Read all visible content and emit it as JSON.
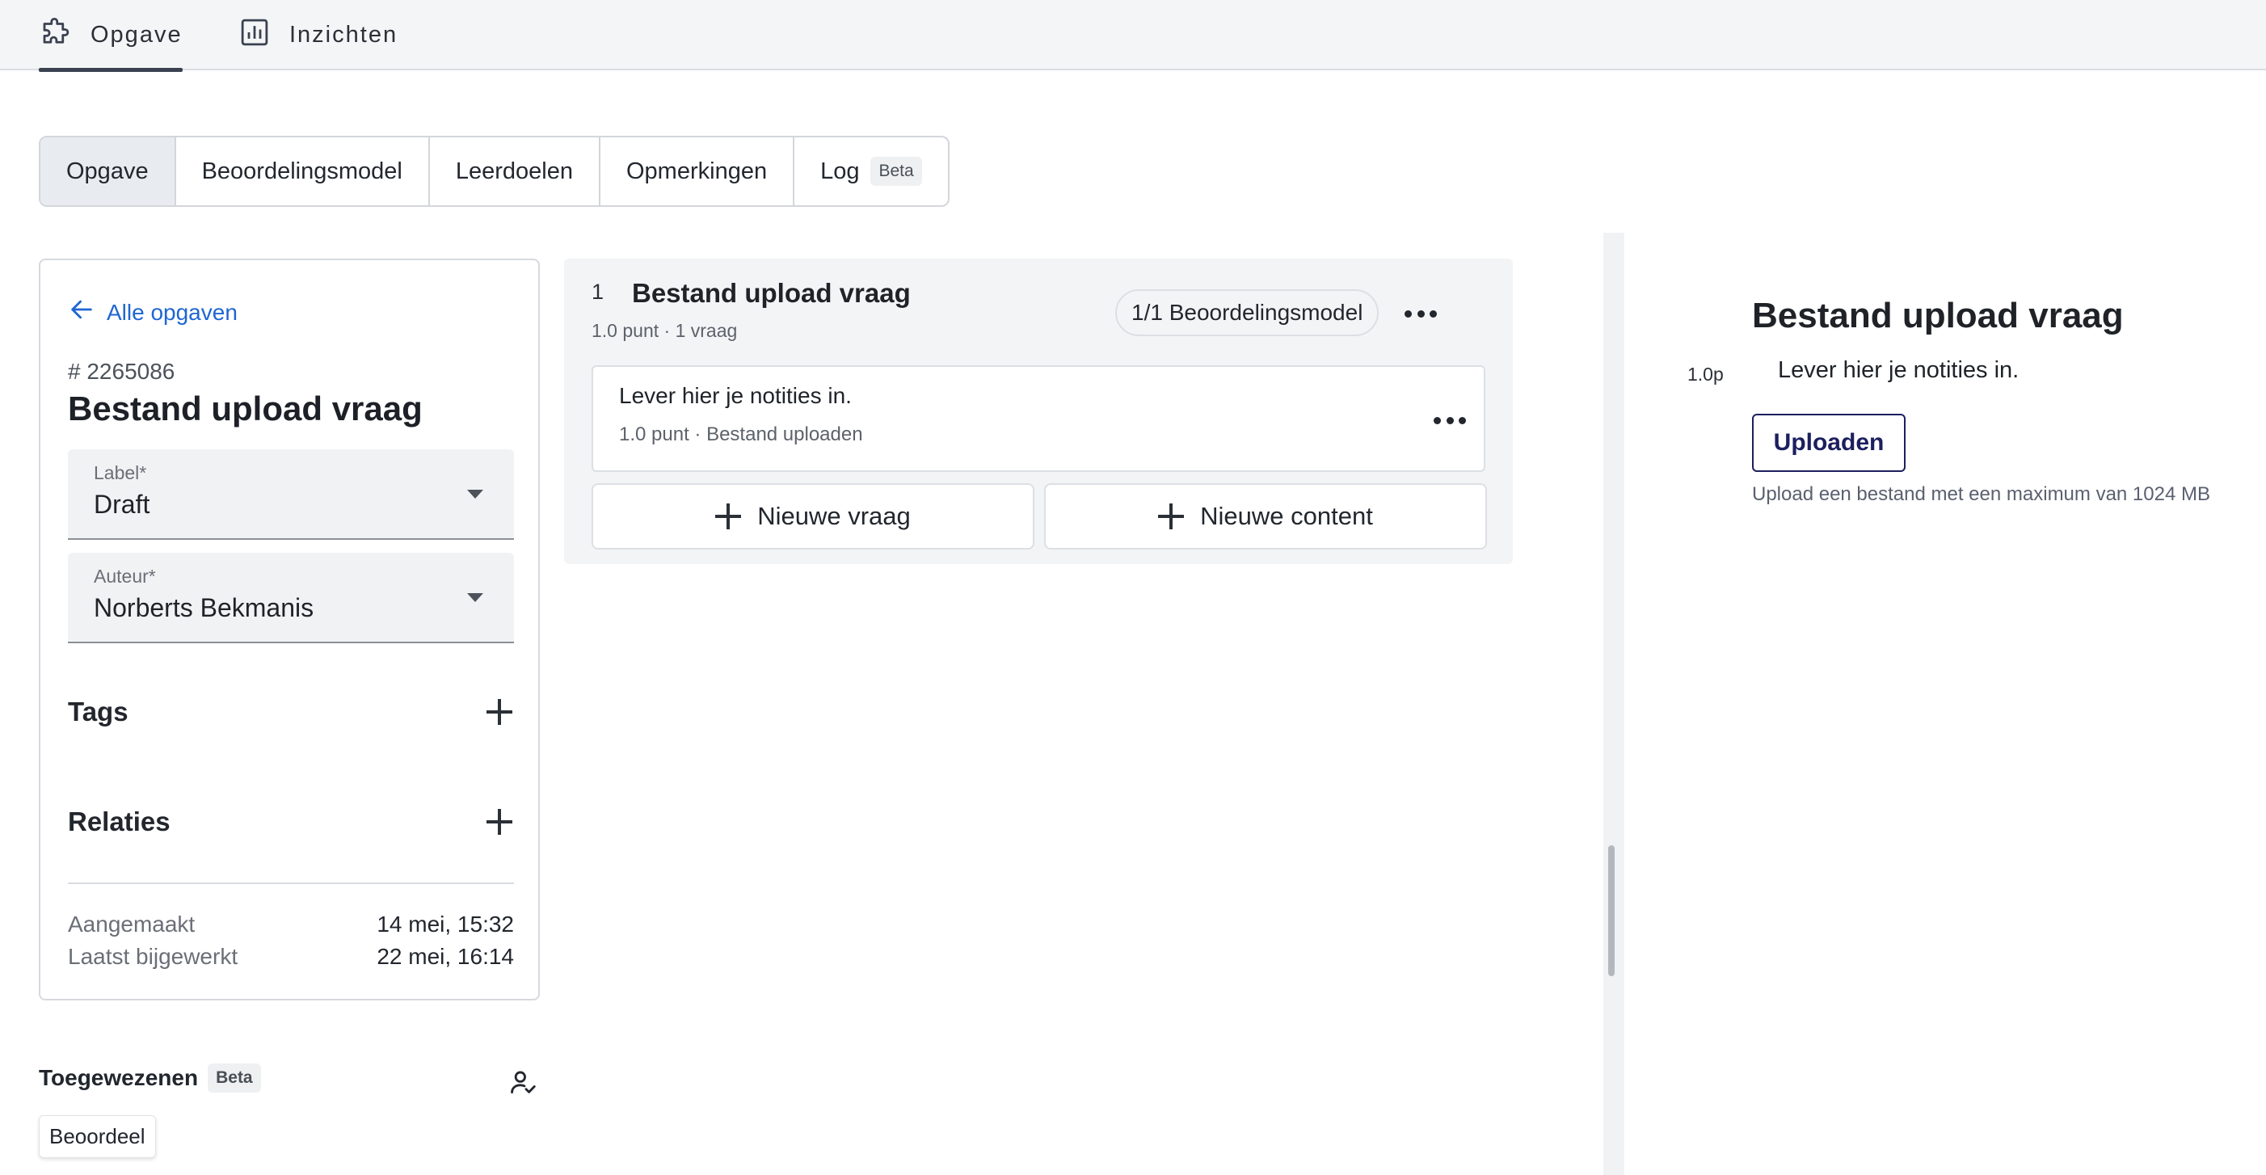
{
  "topnav": {
    "tabs": [
      {
        "label": "Opgave",
        "icon": "puzzle-icon",
        "active": true
      },
      {
        "label": "Inzichten",
        "icon": "chart-icon",
        "active": false
      }
    ]
  },
  "subtabs": {
    "items": [
      {
        "label": "Opgave",
        "active": true
      },
      {
        "label": "Beoordelingsmodel"
      },
      {
        "label": "Leerdoelen"
      },
      {
        "label": "Opmerkingen"
      },
      {
        "label": "Log",
        "badge": "Beta"
      }
    ]
  },
  "sidebar": {
    "back_label": "Alle opgaven",
    "id": "# 2265086",
    "title": "Bestand upload vraag",
    "label_field": {
      "label": "Label*",
      "value": "Draft"
    },
    "author_field": {
      "label": "Auteur*",
      "value": "Norberts Bekmanis"
    },
    "tags_heading": "Tags",
    "relations_heading": "Relaties",
    "created_label": "Aangemaakt",
    "created_value": "14 mei, 15:32",
    "updated_label": "Laatst bijgewerkt",
    "updated_value": "22 mei, 16:14"
  },
  "assigned": {
    "heading": "Toegewezenen",
    "badge": "Beta",
    "chip": "Beoordeel"
  },
  "question": {
    "number": "1",
    "title": "Bestand upload vraag",
    "subtitle": "1.0 punt · 1 vraag",
    "rubric_pill": "1/1 Beoordelingsmodel",
    "item": {
      "text": "Lever hier je notities in.",
      "meta": "1.0 punt · Bestand uploaden"
    },
    "new_question": "Nieuwe vraag",
    "new_content": "Nieuwe content"
  },
  "preview": {
    "title": "Bestand upload vraag",
    "points": "1.0p",
    "question": "Lever hier je notities in.",
    "upload_button": "Uploaden",
    "upload_help": "Upload een bestand met een maximum van 1024 MB"
  },
  "colors": {
    "link": "#1f66d1",
    "upload_button": "#1c1f5e"
  }
}
